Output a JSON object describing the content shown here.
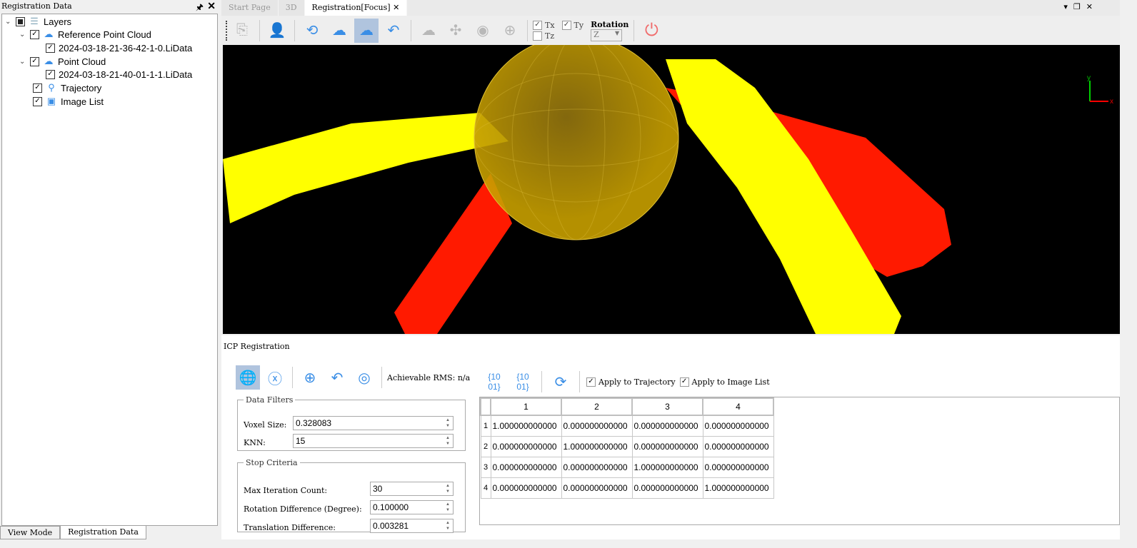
{
  "left_panel": {
    "title": "Registration Data",
    "pin_icon": "pin-icon",
    "close_icon": "close-icon",
    "tree": {
      "root": "Layers",
      "ref_cloud": "Reference Point Cloud",
      "ref_file": "2024-03-18-21-36-42-1-0.LiData",
      "cloud": "Point Cloud",
      "cloud_file": "2024-03-18-21-40-01-1-1.LiData",
      "trajectory": "Trajectory",
      "image_list": "Image List"
    },
    "bottom_tabs": [
      "View Mode",
      "Registration Data"
    ]
  },
  "doc_tabs": [
    "Start Page",
    "3D",
    "Registration[Focus]"
  ],
  "toolbar": {
    "tx": "Tx",
    "ty": "Ty",
    "tz": "Tz",
    "tx_checked": true,
    "ty_checked": true,
    "tz_checked": false,
    "rotation_label": "Rotation",
    "rotation_value": "Z"
  },
  "viewport": {
    "axis_x": "x",
    "axis_y": "y",
    "colors": {
      "reference": "#ffff00",
      "cloud": "#ff0000",
      "sphere": "#c8a000"
    }
  },
  "icp": {
    "title": "ICP Registration",
    "rms": "Achievable RMS: n/a",
    "data_filters": {
      "legend": "Data Filters",
      "voxel_label": "Voxel Size:",
      "voxel_value": "0.328083",
      "knn_label": "KNN:",
      "knn_value": "15"
    },
    "stop_criteria": {
      "legend": "Stop Criteria",
      "max_iter_label": "Max Iteration Count:",
      "max_iter_value": "30",
      "rot_label": "Rotation Difference (Degree):",
      "rot_value": "0.100000",
      "trans_label": "Translation Difference:",
      "trans_value": "0.003281"
    },
    "apply_traj": "Apply to Trajectory",
    "apply_img": "Apply to Image List",
    "matrix": {
      "cols": [
        "1",
        "2",
        "3",
        "4"
      ],
      "rows": [
        [
          "1",
          "1.000000000000",
          "0.000000000000",
          "0.000000000000",
          "0.000000000000"
        ],
        [
          "2",
          "0.000000000000",
          "1.000000000000",
          "0.000000000000",
          "0.000000000000"
        ],
        [
          "3",
          "0.000000000000",
          "0.000000000000",
          "1.000000000000",
          "0.000000000000"
        ],
        [
          "4",
          "0.000000000000",
          "0.000000000000",
          "0.000000000000",
          "1.000000000000"
        ]
      ]
    }
  }
}
